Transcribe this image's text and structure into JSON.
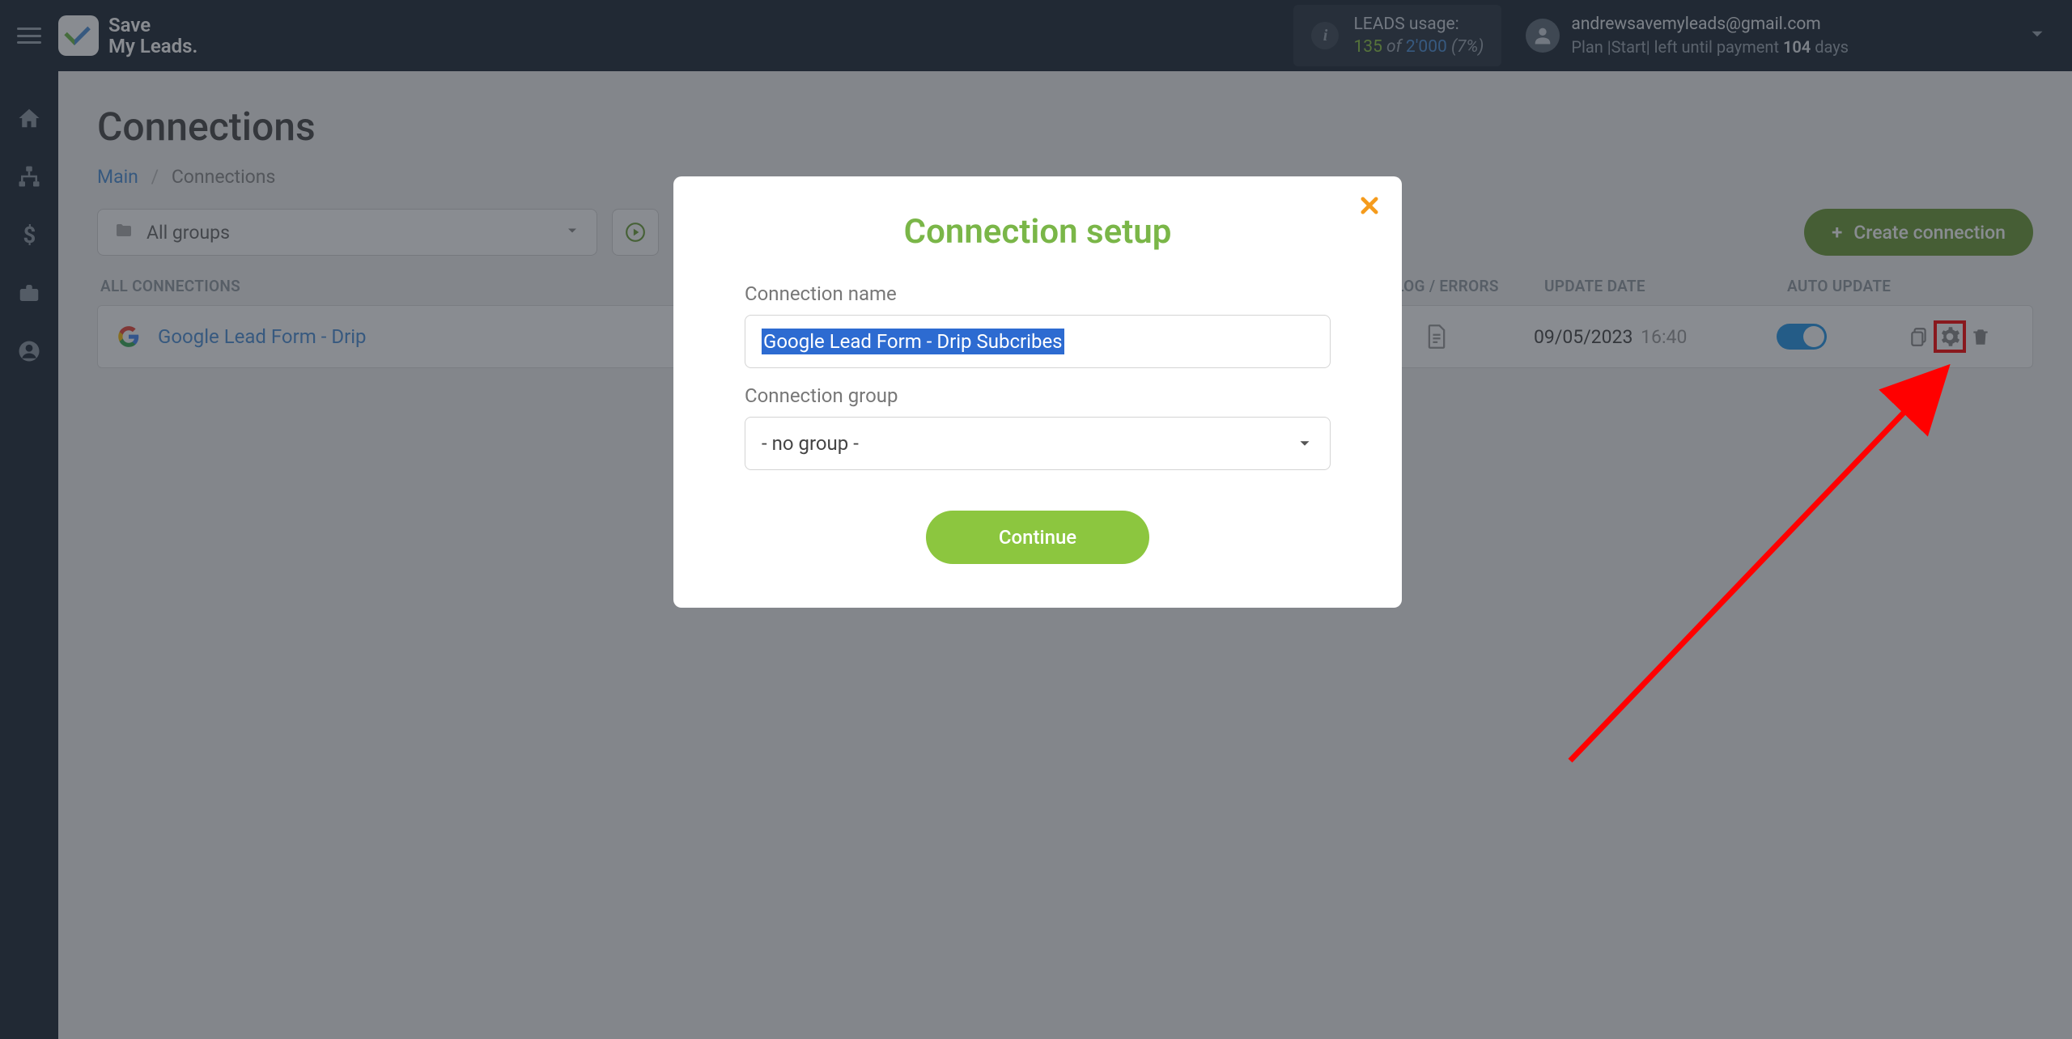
{
  "header": {
    "logo_line1": "Save",
    "logo_line2": "My Leads.",
    "usage_label": "LEADS usage:",
    "usage_count": "135",
    "usage_of": " of ",
    "usage_total": "2'000",
    "usage_pct": " (7%)",
    "account_email": "andrewsavemyleads@gmail.com",
    "account_plan_prefix": "Plan |Start| left until payment ",
    "account_plan_days": "104",
    "account_plan_suffix": " days"
  },
  "page": {
    "title": "Connections",
    "breadcrumb_main": "Main",
    "breadcrumb_sep": "/",
    "breadcrumb_current": "Connections",
    "group_select": "All groups",
    "create_button": "Create connection"
  },
  "table": {
    "h_all": "ALL CONNECTIONS",
    "h_log": "LOG / ERRORS",
    "h_update": "UPDATE DATE",
    "h_auto": "AUTO UPDATE",
    "row_name": "Google Lead Form - Drip",
    "row_date": "09/05/2023",
    "row_time": "16:40"
  },
  "modal": {
    "title": "Connection setup",
    "label_name": "Connection name",
    "input_value": "Google Lead Form - Drip Subcribes",
    "label_group": "Connection group",
    "group_value": "- no group -",
    "continue": "Continue"
  }
}
